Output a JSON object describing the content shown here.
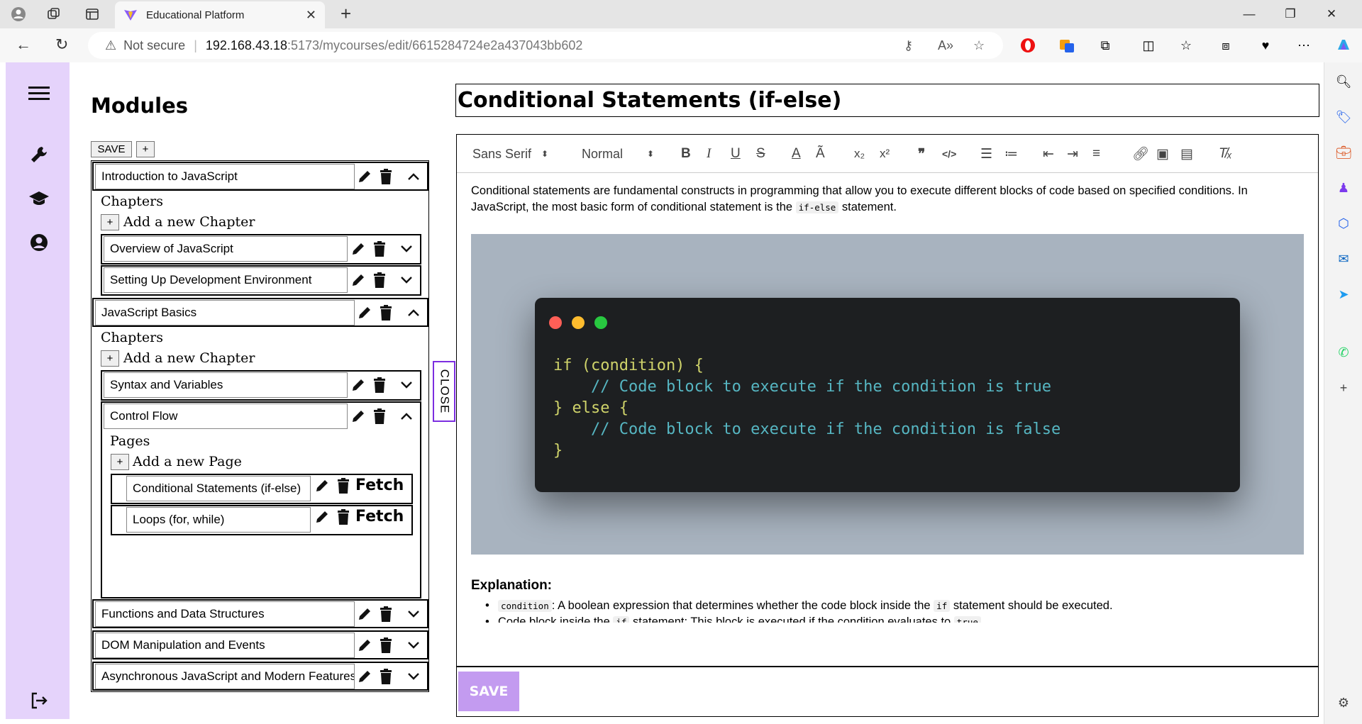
{
  "browser": {
    "tab_title": "Educational Platform",
    "url_warning": "Not secure",
    "url_host": "192.168.43.18",
    "url_path": ":5173/mycourses/edit/6615284724e2a437043bb602"
  },
  "modules_panel": {
    "title": "Modules",
    "save_label": "SAVE",
    "add_label": "+",
    "modules": [
      {
        "name": "Introduction to JavaScript"
      },
      {
        "name": "JavaScript Basics"
      },
      {
        "name": "Functions and Data Structures"
      },
      {
        "name": "DOM Manipulation and Events"
      },
      {
        "name": "Asynchronous JavaScript and Modern Features"
      }
    ],
    "chapters_label": "Chapters",
    "add_chapter_label": "Add a new Chapter",
    "pages_label": "Pages",
    "add_page_label": "Add a new Page",
    "intro_chapters": [
      "Overview of JavaScript",
      "Setting Up Development Environment"
    ],
    "basics_chapters": [
      "Syntax and Variables",
      "Control Flow"
    ],
    "pages": [
      "Conditional Statements (if-else)",
      "Loops (for, while)"
    ],
    "fetch_label": "Fetch",
    "close_label": "CLOSE"
  },
  "editor": {
    "title": "Conditional Statements (if-else)",
    "font_select": "Sans Serif",
    "size_select": "Normal",
    "paragraph_1a": "Conditional statements are fundamental constructs in programming that allow you to execute different blocks of code based on specified conditions. In JavaScript, the most basic form of conditional statement is the ",
    "paragraph_1_code": "if-else",
    "paragraph_1b": " statement.",
    "code_lines": [
      "if (condition) {",
      "    // Code block to execute if the condition is true",
      "} else {",
      "    // Code block to execute if the condition is false",
      "}"
    ],
    "explanation_heading": "Explanation:",
    "bullet_1_code": "condition",
    "bullet_1_text": ": A boolean expression that determines whether the code block inside the ",
    "bullet_1_code2": "if",
    "bullet_1_text2": " statement should be executed.",
    "bullet_2_text": "Code block inside the ",
    "bullet_2_code": "if",
    "bullet_2_text2": " statement: This block is executed if the condition evaluates to ",
    "bullet_2_code2": "true",
    "bullet_2_text3": ".",
    "save_label": "SAVE"
  },
  "colors": {
    "sidebar": "#e5d3fb",
    "save_button": "#c39bf0",
    "close_border": "#7c2ee0",
    "code_bg": "#1d1f21"
  }
}
